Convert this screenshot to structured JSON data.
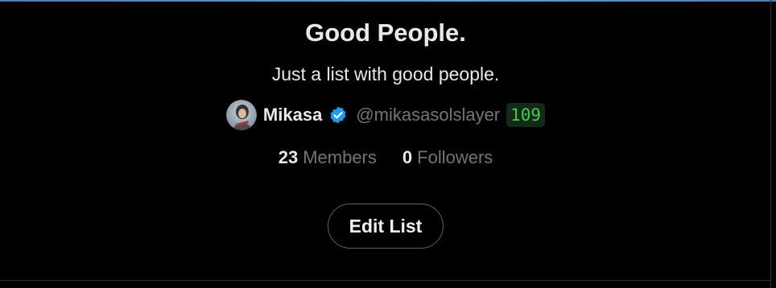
{
  "list": {
    "title": "Good People.",
    "description": "Just a list with good people."
  },
  "owner": {
    "name": "Mikasa",
    "handle": "@mikasasolslayer",
    "badge_count": "109",
    "verified_icon": "verified-badge-icon",
    "avatar_icon": "avatar"
  },
  "stats": {
    "members_count": "23",
    "members_label": "Members",
    "followers_count": "0",
    "followers_label": "Followers"
  },
  "actions": {
    "edit_label": "Edit List"
  },
  "colors": {
    "background": "#000000",
    "text_primary": "#e7e9ea",
    "text_secondary": "#71767b",
    "verified_blue": "#1d9bf0",
    "badge_green": "#3dd14a",
    "button_border": "#536471"
  }
}
